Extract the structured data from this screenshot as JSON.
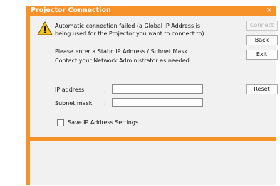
{
  "window": {
    "title": "Projector Connection",
    "close_glyph": "×"
  },
  "message": {
    "icon": "warning-icon",
    "line1": "Automatic connection failed (a Global IP Address is",
    "line2": "being used for the Projector you want to connect to).",
    "line3": "Please enter a Static IP Address / Subnet Mask.",
    "line4": "Contact your Network Administrator as needed."
  },
  "buttons": {
    "connect": "Connect",
    "back": "Back",
    "exit": "Exit",
    "reset": "Reset"
  },
  "form": {
    "ip_label": "IP address",
    "ip_value": "",
    "subnet_label": "Subnet mask",
    "subnet_value": "",
    "colon": ":",
    "save_checkbox_label": "Save IP Address Settings",
    "save_checked": false
  },
  "colors": {
    "accent": "#f7922a",
    "panel": "#f1f1f1"
  }
}
